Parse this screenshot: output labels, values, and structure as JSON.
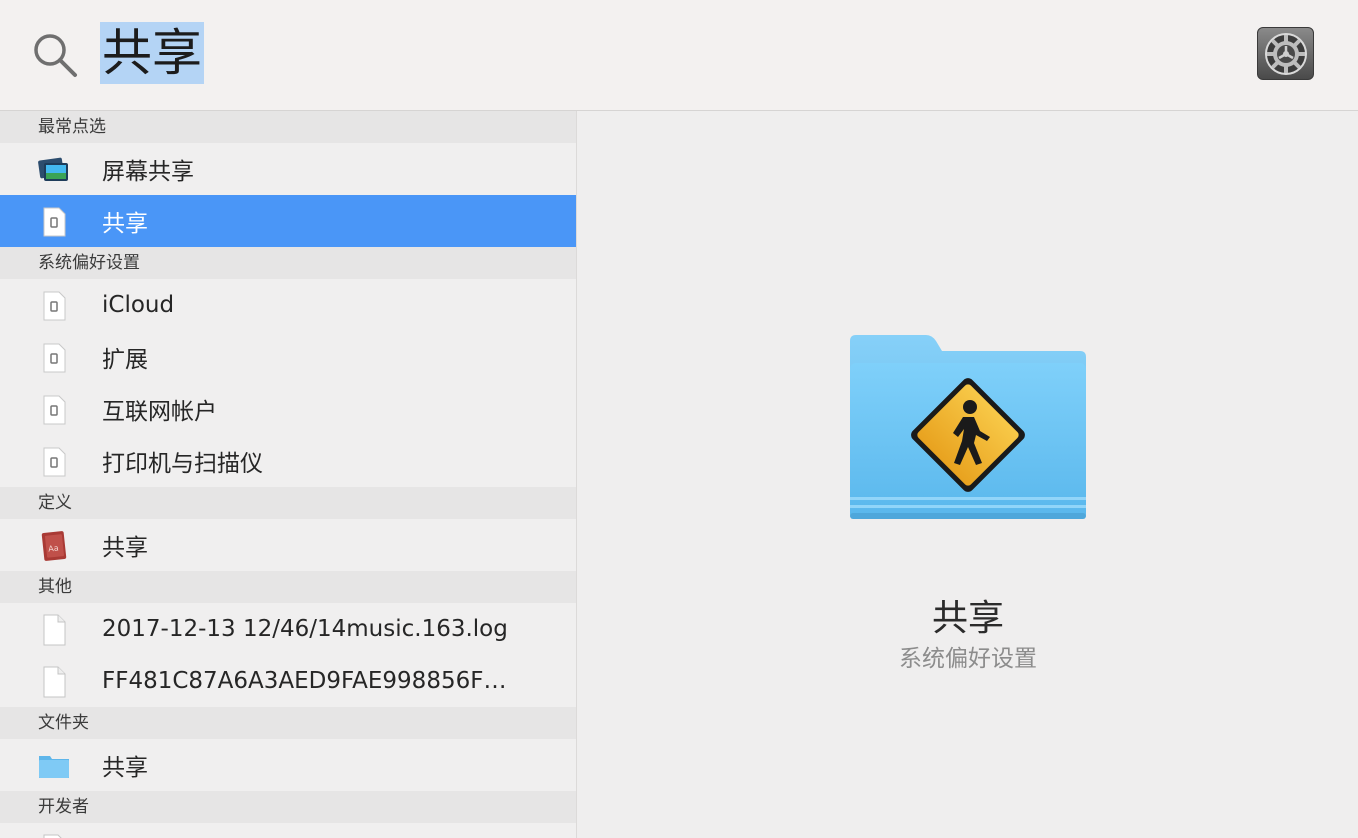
{
  "search": {
    "query": "共享"
  },
  "sections": [
    {
      "header": "最常点选",
      "items": [
        {
          "label": "屏幕共享",
          "icon": "screen-sharing-icon"
        },
        {
          "label": "共享",
          "icon": "preference-pane-icon",
          "selected": true
        }
      ]
    },
    {
      "header": "系统偏好设置",
      "items": [
        {
          "label": "iCloud",
          "icon": "preference-pane-icon"
        },
        {
          "label": "扩展",
          "icon": "preference-pane-icon"
        },
        {
          "label": "互联网帐户",
          "icon": "preference-pane-icon"
        },
        {
          "label": "打印机与扫描仪",
          "icon": "preference-pane-icon"
        }
      ]
    },
    {
      "header": "定义",
      "items": [
        {
          "label": "共享",
          "icon": "dictionary-icon"
        }
      ]
    },
    {
      "header": "其他",
      "items": [
        {
          "label": "2017-12-13 12/46/14music.163.log",
          "icon": "document-icon"
        },
        {
          "label": "FF481C87A6A3AED9FAE998856F…",
          "icon": "document-icon"
        }
      ]
    },
    {
      "header": "文件夹",
      "items": [
        {
          "label": "共享",
          "icon": "folder-icon"
        }
      ]
    },
    {
      "header": "开发者",
      "items": []
    }
  ],
  "preview": {
    "title": "共享",
    "subtitle": "系统偏好设置",
    "icon": "public-folder-icon"
  },
  "colors": {
    "selection": "#4a96f7",
    "search_highlight": "#b4d4f5",
    "folder": "#6cc4f4"
  }
}
